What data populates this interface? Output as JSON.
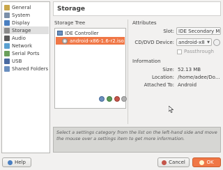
{
  "sidebar": {
    "items": [
      {
        "label": "General",
        "icon": "general-icon",
        "color": "#c9a64a"
      },
      {
        "label": "System",
        "icon": "system-icon",
        "color": "#7b8fa8"
      },
      {
        "label": "Display",
        "icon": "display-icon",
        "color": "#4a7fc1"
      },
      {
        "label": "Storage",
        "icon": "storage-icon",
        "color": "#8a8a8a"
      },
      {
        "label": "Audio",
        "icon": "audio-icon",
        "color": "#5a5a5a"
      },
      {
        "label": "Network",
        "icon": "network-icon",
        "color": "#5aa0d0"
      },
      {
        "label": "Serial Ports",
        "icon": "serial-ports-icon",
        "color": "#6a9f5a"
      },
      {
        "label": "USB",
        "icon": "usb-icon",
        "color": "#4a6aa0"
      },
      {
        "label": "Shared Folders",
        "icon": "shared-folders-icon",
        "color": "#6a8fbf"
      }
    ],
    "active_index": 3
  },
  "header": {
    "title": "Storage"
  },
  "storage_tree": {
    "label": "Storage Tree",
    "controller": "IDE Controller",
    "attachment": "android-x86-1.6-r2.iso"
  },
  "attributes": {
    "label": "Attributes",
    "slot_label": "Slot:",
    "slot_value": "IDE Secondary M",
    "drive_label": "CD/DVD Device:",
    "drive_value": "android-x8",
    "passthrough_label": "Passthrough"
  },
  "information": {
    "label": "Information",
    "size_label": "Size:",
    "size_value": "52.13 MB",
    "location_label": "Location:",
    "location_value": "/home/adee/Do...",
    "attached_label": "Attached To:",
    "attached_value": "Android"
  },
  "info_text": "Select a settings category from the list on the left-hand side and move the mouse over a settings item to get more information.",
  "buttons": {
    "help": "Help",
    "cancel": "Cancel",
    "ok": "OK"
  },
  "colors": {
    "accent": "#f07746",
    "sidebar_active": "#e0e0e0",
    "info_bg": "#d6d6d3"
  }
}
